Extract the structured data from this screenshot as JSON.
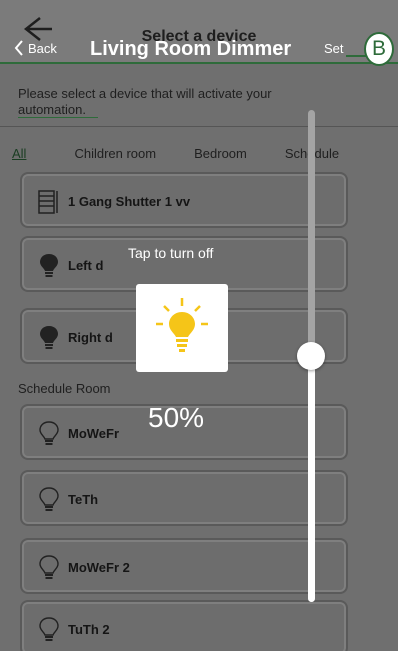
{
  "background_screen": {
    "title": "Select a device",
    "description": "Please select a device that will activate your automation.",
    "tabs": [
      {
        "label": "All",
        "active": true
      },
      {
        "label": "Children room",
        "active": false
      },
      {
        "label": "Bedroom",
        "active": false
      },
      {
        "label": "Schedule",
        "active": false
      }
    ],
    "section_label": "Schedule Room",
    "devices": [
      {
        "label": "1 Gang Shutter 1 vv",
        "icon": "shutter-icon"
      },
      {
        "label": "Left d",
        "icon": "bulb-icon"
      },
      {
        "label": "Right d",
        "icon": "bulb-icon"
      },
      {
        "label": "MoWeFr",
        "icon": "bulb-outline-icon"
      },
      {
        "label": "TeTh",
        "icon": "bulb-outline-icon"
      },
      {
        "label": "MoWeFr 2",
        "icon": "bulb-outline-icon"
      },
      {
        "label": "TuTh 2",
        "icon": "bulb-outline-icon"
      }
    ]
  },
  "dimmer": {
    "back_label": "Back",
    "title": "Living Room Dimmer",
    "set_label": "Set",
    "hint": "Tap to turn off",
    "percent_label": "50%",
    "level": 0.5
  },
  "callout": {
    "label": "B"
  },
  "colors": {
    "accent": "#2e6b3a",
    "bulb": "#f5c518",
    "overlay_text": "#ffffff"
  }
}
